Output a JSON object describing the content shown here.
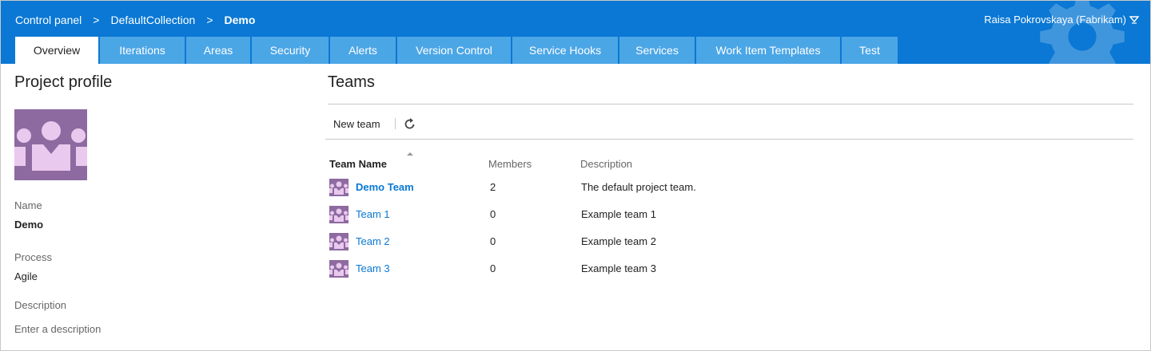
{
  "colors": {
    "header_bg": "#0a78d4",
    "tab_bg": "#4ba6e6",
    "link": "#0a78d4",
    "avatar": "#8d6aa0"
  },
  "breadcrumb": {
    "root": "Control panel",
    "collection": "DefaultCollection",
    "project": "Demo",
    "separator": ">"
  },
  "user": {
    "name": "Raisa Pokrovskaya (Fabrikam)",
    "menu_icon": "chevron-down-icon"
  },
  "tabs": [
    {
      "label": "Overview",
      "active": true
    },
    {
      "label": "Iterations"
    },
    {
      "label": "Areas"
    },
    {
      "label": "Security"
    },
    {
      "label": "Alerts"
    },
    {
      "label": "Version Control"
    },
    {
      "label": "Service Hooks"
    },
    {
      "label": "Services"
    },
    {
      "label": "Work Item Templates"
    },
    {
      "label": "Test"
    }
  ],
  "profile": {
    "title": "Project profile",
    "name_label": "Name",
    "name_value": "Demo",
    "process_label": "Process",
    "process_value": "Agile",
    "description_label": "Description",
    "description_placeholder": "Enter a description"
  },
  "teams": {
    "title": "Teams",
    "new_team_label": "New team",
    "refresh_icon": "refresh-icon",
    "columns": {
      "name": "Team Name",
      "members": "Members",
      "description": "Description"
    },
    "rows": [
      {
        "name": "Demo Team",
        "members": "2",
        "description": "The default project team.",
        "default": true
      },
      {
        "name": "Team 1",
        "members": "0",
        "description": "Example team 1"
      },
      {
        "name": "Team 2",
        "members": "0",
        "description": "Example team 2"
      },
      {
        "name": "Team 3",
        "members": "0",
        "description": "Example team 3"
      }
    ]
  }
}
